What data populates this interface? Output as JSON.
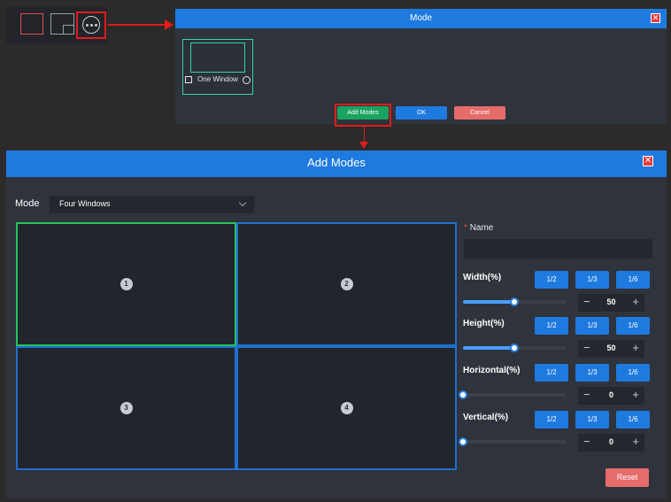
{
  "toolbar": {
    "icons": [
      "one-window-icon",
      "overlap-window-icon",
      "more-icon"
    ]
  },
  "mode_dialog": {
    "title": "Mode",
    "close_symbol": "✕",
    "tile_label": "One Window",
    "add_label": "Add Modes",
    "ok_label": "OK",
    "cancel_label": "Cancel"
  },
  "add_dialog": {
    "title": "Add Modes",
    "close_symbol": "✕",
    "mode_label": "Mode",
    "mode_value": "Four Windows",
    "windows": [
      "1",
      "2",
      "3",
      "4"
    ],
    "name_required": "*",
    "name_label": "Name",
    "name_value": "",
    "fractions": [
      "1/2",
      "1/3",
      "1/6"
    ],
    "props": [
      {
        "label": "Width(%)",
        "value": "50",
        "fill": 0.5
      },
      {
        "label": "Height(%)",
        "value": "50",
        "fill": 0.5
      },
      {
        "label": "Horizontal(%)",
        "value": "0",
        "fill": 0
      },
      {
        "label": "Vertical(%)",
        "value": "0",
        "fill": 0
      }
    ],
    "minus_symbol": "−",
    "plus_symbol": "+",
    "reset_label": "Reset"
  },
  "colors": {
    "accent": "#1f7ae0",
    "success": "#1aa260",
    "danger": "#e66b6b",
    "highlight": "#e31b1b",
    "active_window": "#22c55e"
  }
}
